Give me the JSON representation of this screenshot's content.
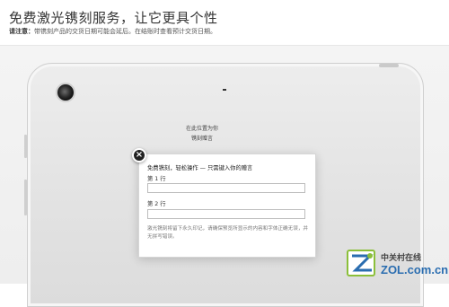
{
  "header": {
    "title": "免费激光镌刻服务，让它更具个性",
    "notice_label": "请注意：",
    "notice_text": "带镌刻产品的交货日期可能会延后。在结账时查看预计交货日期。"
  },
  "device": {
    "engrave_hint_line1": "在此位置为你",
    "engrave_hint_line2": "镌刻赠言"
  },
  "dialog": {
    "title": "免费镌刻，轻松操作 — 只需键入你的赠言",
    "line1_label": "第 1 行",
    "line1_value": "",
    "line2_label": "第 2 行",
    "line2_value": "",
    "note": "激光镌刻将留下永久印记，请确保预览所显示的内容和字体正确无误，并无拼写错误。",
    "close_glyph": "×"
  },
  "watermark": {
    "brand_cn": "中关村在线",
    "brand_en": "ZOL.com.cn"
  },
  "colors": {
    "accent": "#2a6db0",
    "dialog_bg": "#ffffff",
    "close_bg": "#222222"
  }
}
